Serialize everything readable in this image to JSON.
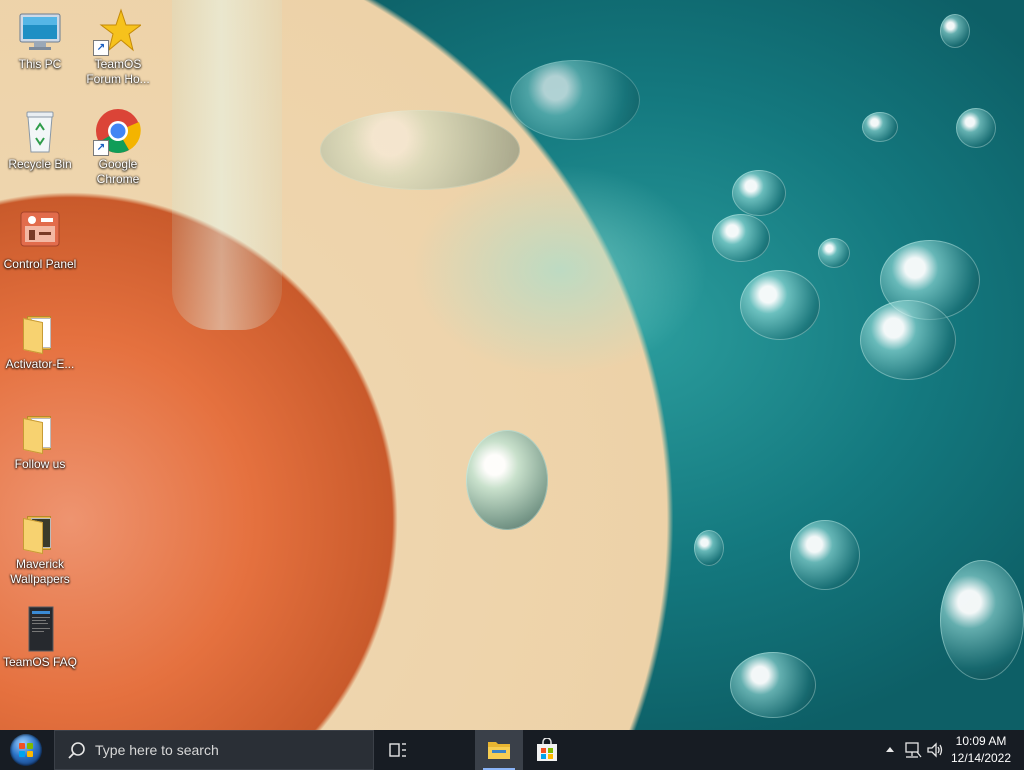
{
  "desktop": {
    "icons": [
      {
        "label": "This PC",
        "icon": "this-pc-icon"
      },
      {
        "label": "TeamOS Forum Ho...",
        "icon": "teamos-star-icon"
      },
      {
        "label": "Recycle Bin",
        "icon": "recycle-bin-icon"
      },
      {
        "label": "Google Chrome",
        "icon": "chrome-icon"
      },
      {
        "label": "Control Panel",
        "icon": "control-panel-icon"
      },
      {
        "label": "Activator-E...",
        "icon": "folder-icon"
      },
      {
        "label": "Follow us",
        "icon": "folder-icon"
      },
      {
        "label": "Maverick Wallpapers",
        "icon": "folder-icon"
      },
      {
        "label": "TeamOS FAQ",
        "icon": "document-icon"
      }
    ]
  },
  "taskbar": {
    "search_placeholder": "Type here to search",
    "time": "10:09 AM",
    "date": "12/14/2022",
    "pinned": [
      "task-view",
      "file-explorer",
      "microsoft-store"
    ]
  },
  "colors": {
    "taskbar_bg": "#171c23",
    "accent": "#8ab4f8"
  }
}
